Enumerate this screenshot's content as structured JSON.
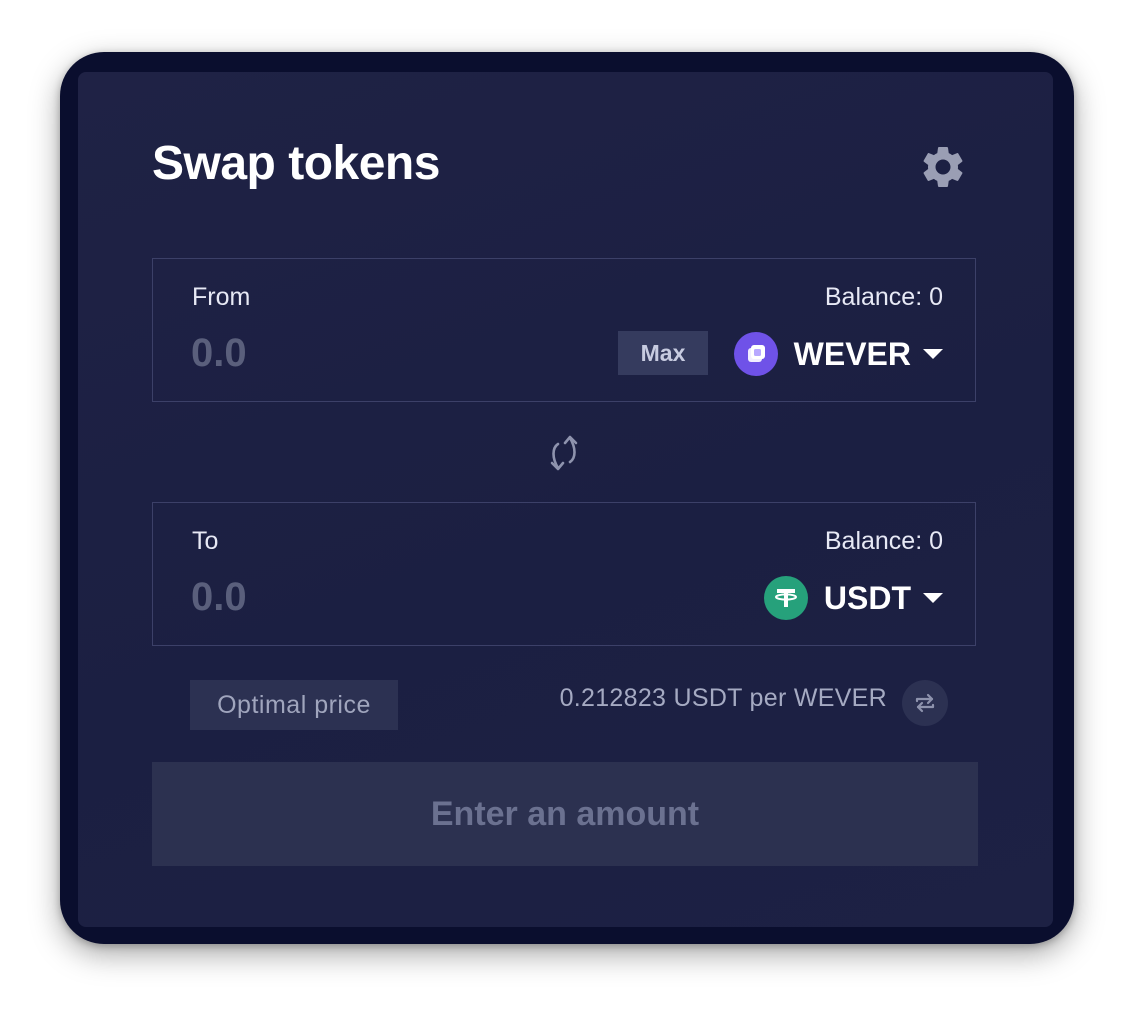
{
  "header": {
    "title": "Swap tokens",
    "settings_icon": "gear-icon"
  },
  "from": {
    "label": "From",
    "balance": "Balance: 0",
    "amount_placeholder": "0.0",
    "max_label": "Max",
    "token": {
      "symbol": "WEVER",
      "icon": "wever-token-icon",
      "color": "#6f52e8"
    }
  },
  "swap_direction_icon": "swap-arrows-icon",
  "to": {
    "label": "To",
    "balance": "Balance: 0",
    "amount_placeholder": "0.0",
    "token": {
      "symbol": "USDT",
      "icon": "tether-token-icon",
      "color": "#26a17b"
    }
  },
  "price": {
    "badge": "Optimal price",
    "rate": "0.212823 USDT per WEVER",
    "toggle_icon": "repeat-icon"
  },
  "submit": {
    "label": "Enter an amount",
    "disabled": true
  },
  "colors": {
    "frame": "#0a0e2e",
    "card": "#1d2144",
    "border": "#3c4068",
    "muted_button": "#2c3150"
  }
}
